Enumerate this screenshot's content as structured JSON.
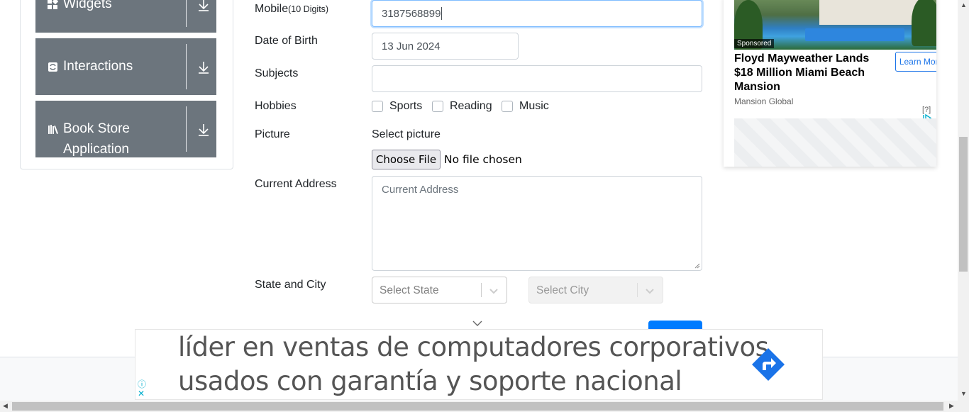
{
  "sidebar": {
    "groups": [
      {
        "label": "Widgets",
        "icon": "widgets-icon"
      },
      {
        "label": "Interactions",
        "icon": "interactions-icon"
      },
      {
        "label_line1": "Book Store",
        "label_line2": "Application",
        "icon": "books-icon"
      }
    ]
  },
  "form": {
    "mobile": {
      "label": "Mobile",
      "hint": "(10 Digits)",
      "value": "3187568899"
    },
    "dob": {
      "label": "Date of Birth",
      "value": "13 Jun 2024"
    },
    "subjects": {
      "label": "Subjects",
      "value": ""
    },
    "hobbies": {
      "label": "Hobbies",
      "options": [
        "Sports",
        "Reading",
        "Music"
      ]
    },
    "picture": {
      "label": "Picture",
      "select_text": "Select picture",
      "button": "Choose File",
      "status": "No file chosen"
    },
    "address": {
      "label": "Current Address",
      "placeholder": "Current Address"
    },
    "state_city": {
      "label": "State and City",
      "state_placeholder": "Select State",
      "city_placeholder": "Select City"
    }
  },
  "ad_right": {
    "sponsored": "Sponsored",
    "title": "Floyd Mayweather Lands $18 Million Miami Beach Mansion",
    "source": "Mansion Global",
    "cta": "Learn More",
    "info": "[?]"
  },
  "ad_bottom": {
    "line1": "líder en ventas de computadores corporativos",
    "line2": "usados con garantía y soporte nacional"
  },
  "colors": {
    "sidebar_group": "#6c757d",
    "primary": "#007bff",
    "ad_accent": "#1a73e8"
  }
}
